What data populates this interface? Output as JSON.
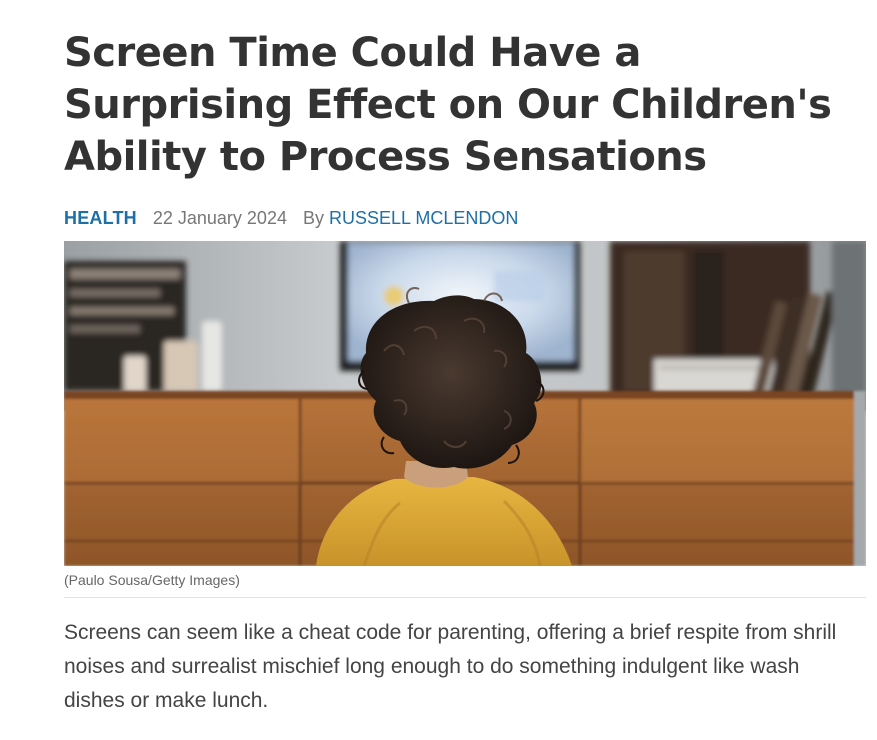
{
  "article": {
    "headline": "Screen Time Could Have a Surprising Effect on Our Children's Ability to Process Sensations",
    "category": "HEALTH",
    "date": "22 January 2024",
    "byline_prefix": "By",
    "author": "RUSSELL MCLENDON",
    "image_alt": "Toddler with curly hair in a yellow sweater watching a television on a wooden dresser",
    "image_caption": "(Paulo Sousa/Getty Images)",
    "lede": "Screens can seem like a cheat code for parenting, offering a brief respite from shrill noises and surrealist mischief long enough to do something indulgent like wash dishes or make lunch."
  },
  "colors": {
    "link": "#1d6fa8",
    "headline": "#333333",
    "meta": "#777777",
    "body": "#444444"
  }
}
